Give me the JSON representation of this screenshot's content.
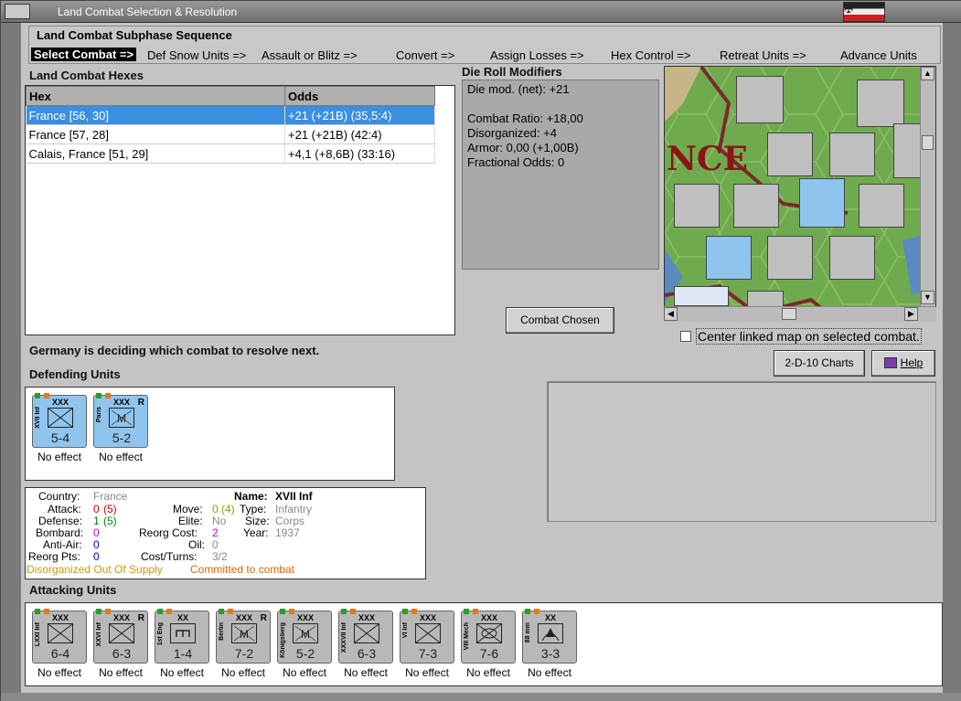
{
  "window": {
    "title": "Land Combat Selection & Resolution"
  },
  "sequence": {
    "heading": "Land Combat Subphase Sequence",
    "steps": [
      "Select Combat =>",
      "Def Snow Units =>",
      "Assault or Blitz =>",
      "Convert =>",
      "Assign Losses =>",
      "Hex Control =>",
      "Retreat Units =>",
      "Advance Units"
    ]
  },
  "hexes": {
    "heading": "Land Combat Hexes",
    "columns": [
      "Hex",
      "Odds"
    ],
    "rows": [
      {
        "hex": "France [56, 30]",
        "odds": "+21 (+21B) (35,5:4)"
      },
      {
        "hex": "France [57, 28]",
        "odds": "+21 (+21B) (42:4)"
      },
      {
        "hex": "Calais, France [51, 29]",
        "odds": "+4,1 (+8,6B) (33:16)"
      }
    ]
  },
  "drm": {
    "heading": "Die Roll Modifiers",
    "lines": [
      "Die mod. (net): +21",
      "",
      "Combat Ratio: +18,00",
      "Disorganized: +4",
      "Armor: 0,00 (+1,00B)",
      "Fractional Odds: 0"
    ]
  },
  "buttons": {
    "combat_chosen": "Combat Chosen",
    "charts": "2-D-10 Charts",
    "help": "Help"
  },
  "map": {
    "label": "NCE",
    "center_linked": "Center linked map on selected combat."
  },
  "status": "Germany is deciding which combat to resolve next.",
  "defending": {
    "heading": "Defending Units",
    "units": [
      {
        "size": "XXX",
        "side": "XVII Inf",
        "str": "5-4",
        "r": "",
        "effect": "No effect",
        "type": "inf"
      },
      {
        "size": "XXX",
        "side": "Paris",
        "str": "5-2",
        "r": "R",
        "effect": "No effect",
        "type": "mech"
      }
    ]
  },
  "info": {
    "country_l": "Country:",
    "country_v": "France",
    "attack_l": "Attack:",
    "attack_v": "0",
    "attack_p": "(5)",
    "defense_l": "Defense:",
    "defense_v": "1",
    "defense_p": "(5)",
    "bombard_l": "Bombard:",
    "bombard_v": "0",
    "antiair_l": "Anti-Air:",
    "antiair_v": "0",
    "reorg_l": "Reorg Pts:",
    "reorg_v": "0",
    "move_l": "Move:",
    "move_v": "0",
    "move_p": "(4)",
    "elite_l": "Elite:",
    "elite_v": "No",
    "reorgcost_l": "Reorg Cost:",
    "reorgcost_v": "2",
    "oil_l": "Oil:",
    "oil_v": "0",
    "cost_l": "Cost/Turns:",
    "cost_v": "3/2",
    "name_l": "Name:",
    "name_v": "XVII Inf",
    "type_l": "Type:",
    "type_v": "Infantry",
    "size_l": "Size:",
    "size_v": "Corps",
    "year_l": "Year:",
    "year_v": "1937",
    "status1": "Disorganized Out Of Supply",
    "status2": "Committed to combat"
  },
  "attacking": {
    "heading": "Attacking Units",
    "units": [
      {
        "size": "XXX",
        "side": "LXXI Inf",
        "str": "6-4",
        "r": "",
        "effect": "No effect",
        "type": "inf"
      },
      {
        "size": "XXX",
        "side": "XXVI Inf",
        "str": "6-3",
        "r": "R",
        "effect": "No effect",
        "type": "inf"
      },
      {
        "size": "XX",
        "side": "1st Eng",
        "str": "1-4",
        "r": "",
        "effect": "No effect",
        "type": "eng"
      },
      {
        "size": "XXX",
        "side": "Berlin",
        "str": "7-2",
        "r": "R",
        "effect": "No effect",
        "type": "mech"
      },
      {
        "size": "XXX",
        "side": "Königsberg",
        "str": "5-2",
        "r": "",
        "effect": "No effect",
        "type": "mech"
      },
      {
        "size": "XXX",
        "side": "XXXVII Inf",
        "str": "6-3",
        "r": "",
        "effect": "No effect",
        "type": "inf"
      },
      {
        "size": "XXX",
        "side": "VI Inf",
        "str": "7-3",
        "r": "",
        "effect": "No effect",
        "type": "inf"
      },
      {
        "size": "XXX",
        "side": "VIII Mech",
        "str": "7-6",
        "r": "",
        "effect": "No effect",
        "type": "mechinf"
      },
      {
        "size": "XX",
        "side": "88 mm",
        "str": "3-3",
        "r": "",
        "effect": "No effect",
        "type": "aa"
      }
    ]
  }
}
